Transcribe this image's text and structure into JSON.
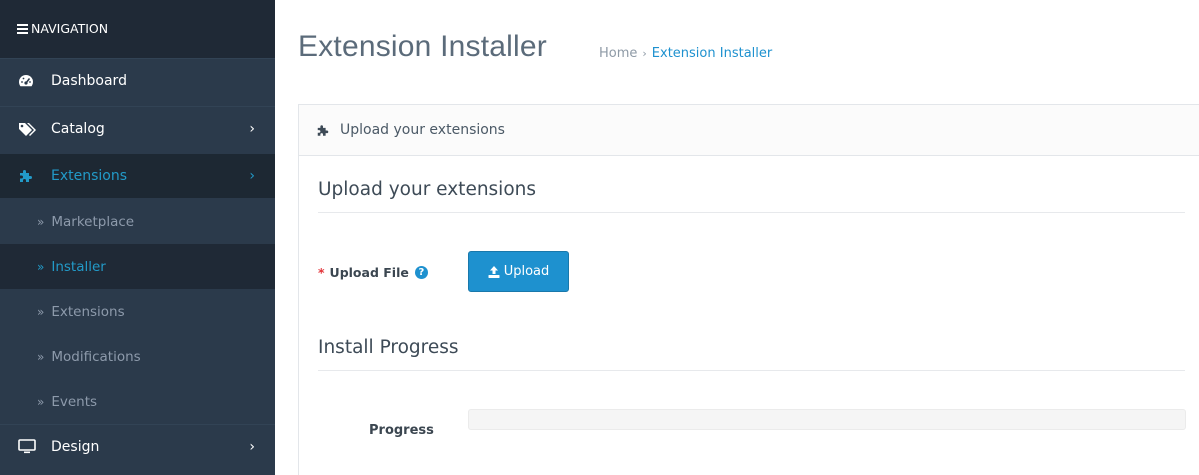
{
  "sidebar": {
    "header": "NAVIGATION",
    "items": [
      {
        "label": "Dashboard",
        "icon": "dashboard-icon"
      },
      {
        "label": "Catalog",
        "icon": "tags-icon",
        "caret": "›"
      },
      {
        "label": "Extensions",
        "icon": "puzzle-icon",
        "caret": "›",
        "active": true
      },
      {
        "label": "Design",
        "icon": "monitor-icon",
        "caret": "›"
      }
    ],
    "sub_items": [
      {
        "label": "Marketplace",
        "arrow": "»"
      },
      {
        "label": "Installer",
        "arrow": "»",
        "active": true
      },
      {
        "label": "Extensions",
        "arrow": "»"
      },
      {
        "label": "Modifications",
        "arrow": "»"
      },
      {
        "label": "Events",
        "arrow": "»"
      }
    ]
  },
  "header": {
    "title": "Extension Installer",
    "breadcrumb": {
      "home": "Home",
      "separator": "›",
      "current": "Extension Installer"
    }
  },
  "panel": {
    "heading": "Upload your extensions",
    "section1_title": "Upload your extensions",
    "upload": {
      "required_mark": "*",
      "label": "Upload File",
      "help_glyph": "?",
      "button_label": "Upload"
    },
    "section2_title": "Install Progress",
    "progress": {
      "label": "Progress",
      "value": 0
    }
  },
  "colors": {
    "accent": "#1e91cf",
    "sidebar_bg": "#2b3a4b",
    "sidebar_dark": "#1f2936",
    "required": "#e3353b"
  }
}
